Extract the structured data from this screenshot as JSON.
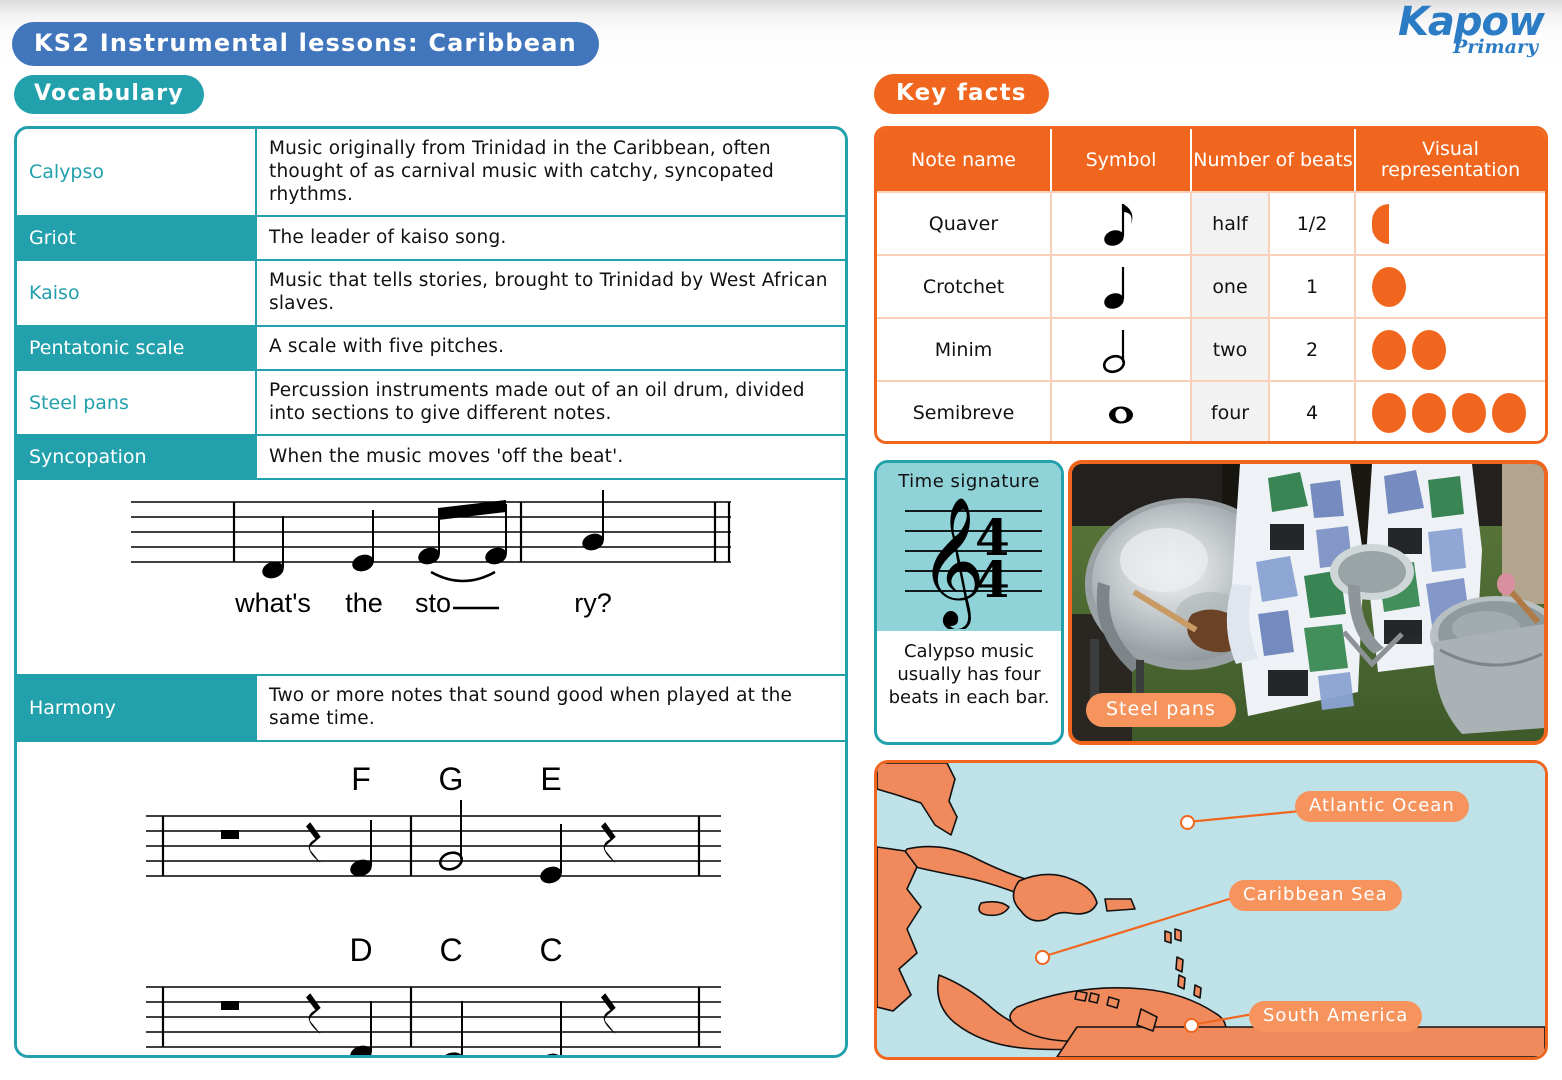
{
  "header": {
    "title": "KS2 Instrumental lessons: Caribbean",
    "vocabulary_pill": "Vocabulary",
    "keyfacts_pill": "Key facts",
    "logo_main": "Kapow",
    "logo_sub": "Primary"
  },
  "colors": {
    "teal": "#22a0ac",
    "teal_light": "#8fd2d8",
    "orange": "#f0661e",
    "orange_light": "#f7945e",
    "blue": "#4176bd",
    "map_sea": "#bfe2e8",
    "grey_cell": "#f2f2f2"
  },
  "vocabulary": {
    "rows": [
      {
        "term": "Calypso",
        "definition": "Music originally from Trinidad in the Caribbean, often thought of as carnival music with catchy, syncopated rhythms.",
        "style": "light"
      },
      {
        "term": "Griot",
        "definition": "The leader of kaiso song.",
        "style": "dark"
      },
      {
        "term": "Kaiso",
        "definition": "Music that tells stories, brought to Trinidad by West African slaves.",
        "style": "light"
      },
      {
        "term": "Pentatonic scale",
        "definition": "A scale with five pitches.",
        "style": "dark"
      },
      {
        "term": "Steel pans",
        "definition": "Percussion instruments made out of an oil drum, divided into sections to give different notes.",
        "style": "light"
      },
      {
        "term": "Syncopation",
        "definition": "When the music moves 'off the beat'.",
        "style": "dark"
      },
      {
        "term": "Harmony",
        "definition": "Two or more notes that sound good when played at the same time.",
        "style": "dark"
      }
    ],
    "lyric_stave": {
      "lyrics": [
        "what's",
        "the",
        "sto",
        "ry?"
      ]
    },
    "harmony_stave_1": {
      "note_letters": [
        "F",
        "G",
        "E"
      ]
    },
    "harmony_stave_2": {
      "note_letters": [
        "D",
        "C",
        "C"
      ]
    }
  },
  "key_facts": {
    "columns": [
      "Note name",
      "Symbol",
      "Number of beats",
      "Visual representation"
    ],
    "rows": [
      {
        "note_name": "Quaver",
        "symbol": "quaver-eighth-note",
        "beats_word": "half",
        "beats_number": "1/2",
        "dots": 0.5
      },
      {
        "note_name": "Crotchet",
        "symbol": "crotchet-quarter-note",
        "beats_word": "one",
        "beats_number": "1",
        "dots": 1
      },
      {
        "note_name": "Minim",
        "symbol": "minim-half-note",
        "beats_word": "two",
        "beats_number": "2",
        "dots": 2
      },
      {
        "note_name": "Semibreve",
        "symbol": "semibreve-whole-note",
        "beats_word": "four",
        "beats_number": "4",
        "dots": 4
      }
    ]
  },
  "time_signature": {
    "label": "Time signature",
    "top_number": "4",
    "bottom_number": "4",
    "caption": "Calypso music usually has four beats in each bar."
  },
  "photo": {
    "caption": "Steel pans"
  },
  "map": {
    "labels": [
      {
        "text": "Atlantic Ocean",
        "id": "lbl-atlantic"
      },
      {
        "text": "Caribbean Sea",
        "id": "lbl-caribbean"
      },
      {
        "text": "South America",
        "id": "lbl-sa"
      }
    ]
  }
}
